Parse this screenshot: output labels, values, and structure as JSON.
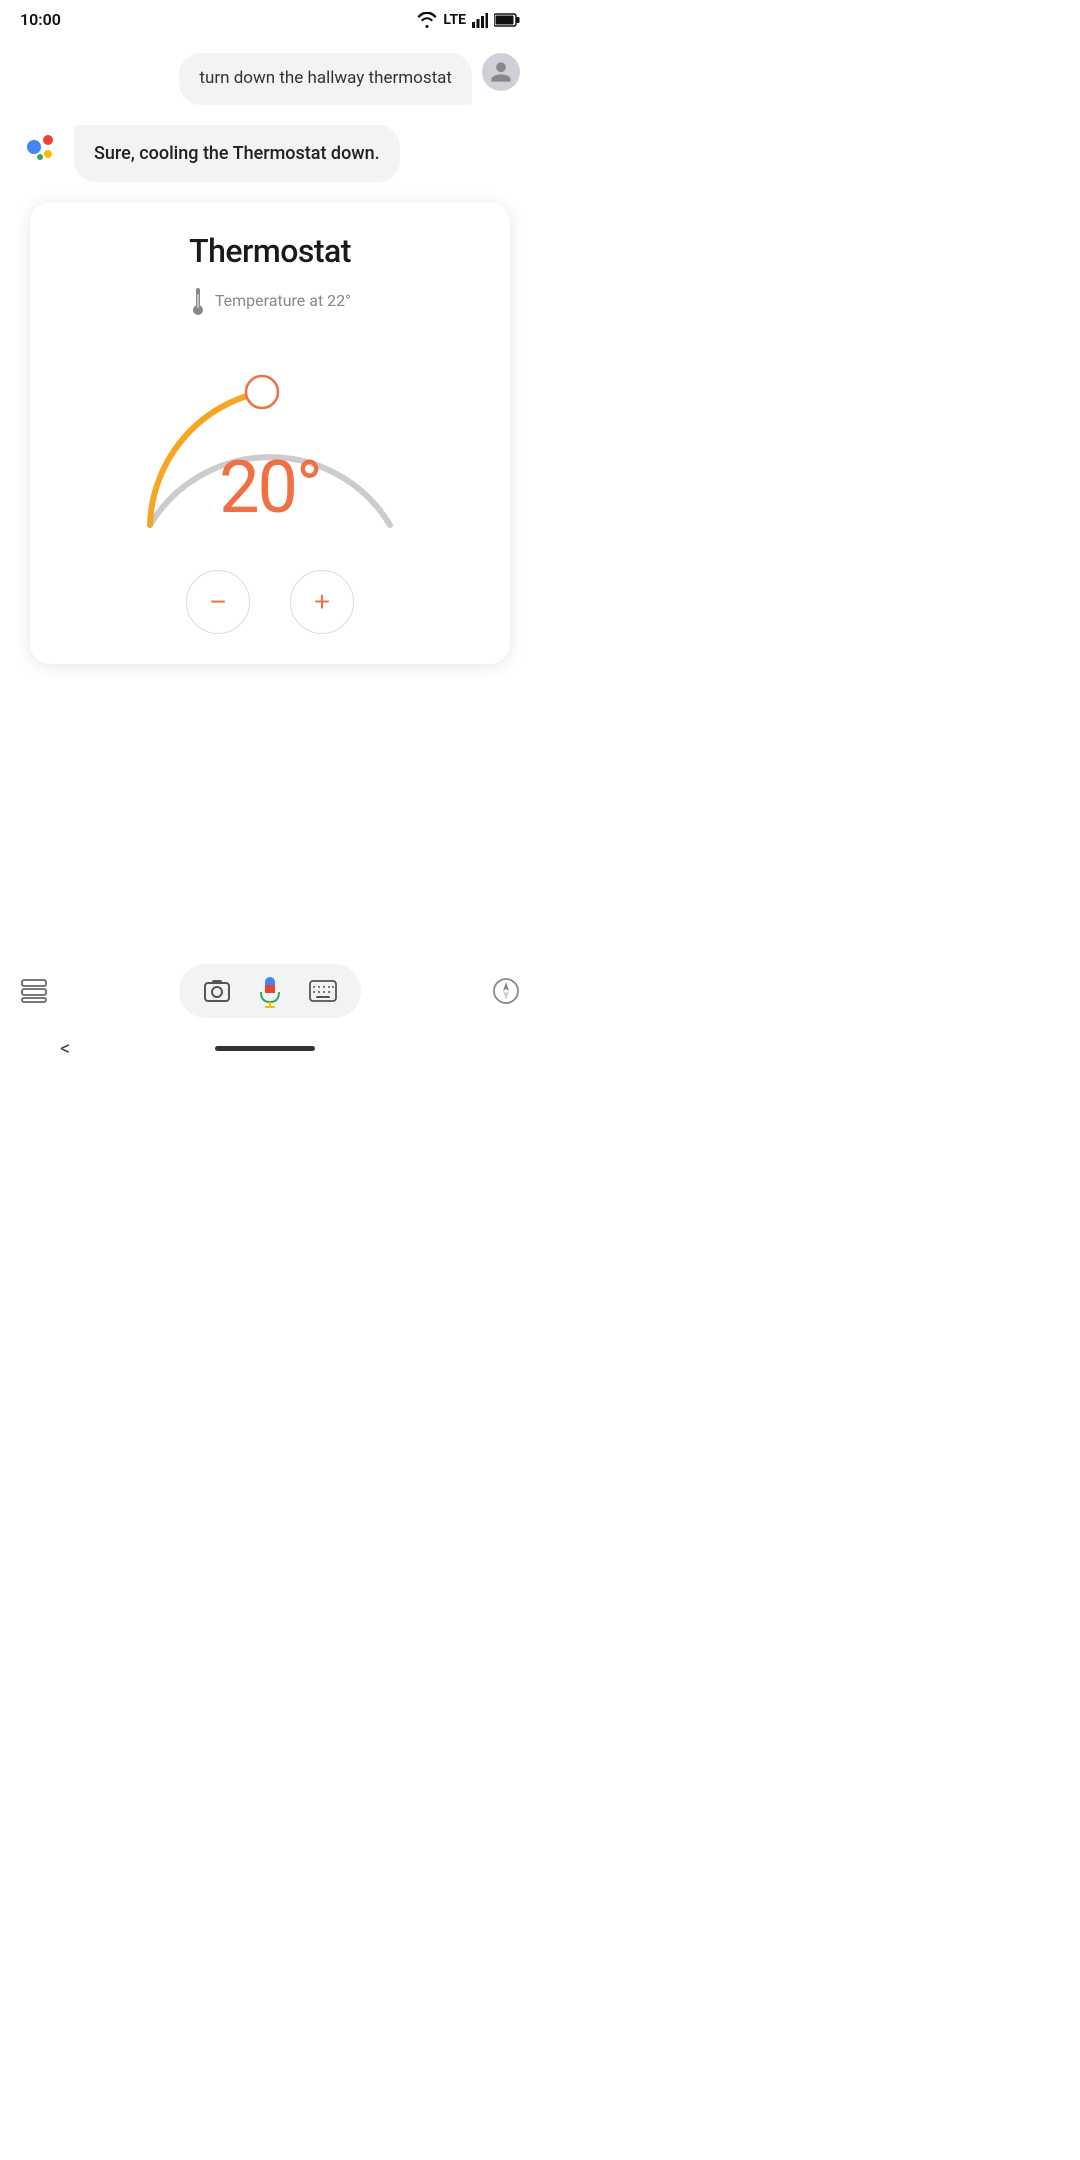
{
  "statusBar": {
    "time": "10:00",
    "wifi": true,
    "lte": "LTE",
    "signal": true,
    "battery": true
  },
  "userMessage": {
    "text": "turn down the hallway thermostat"
  },
  "assistantMessage": {
    "text": "Sure, cooling the Thermostat down."
  },
  "thermostatCard": {
    "title": "Thermostat",
    "temperatureLabel": "Temperature at 22°",
    "currentTemp": "20°",
    "setTemp": 20,
    "maxTemp": 30,
    "minTemp": 10
  },
  "controls": {
    "decreaseLabel": "−",
    "increaseLabel": "+"
  },
  "toolbar": {
    "micLabel": "microphone",
    "cameraLabel": "camera-search",
    "keyboardLabel": "keyboard",
    "compassLabel": "compass",
    "assistantLabel": "google-assistant"
  },
  "nav": {
    "backLabel": "<"
  },
  "colors": {
    "arcActive": "#f5a623",
    "arcInactive": "#cccccc",
    "tempColor": "#f07043",
    "knobBorder": "#f07043",
    "knobFill": "#ffffff"
  }
}
